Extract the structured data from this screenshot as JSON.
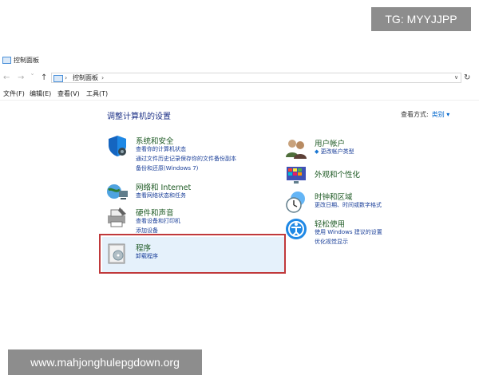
{
  "watermark": {
    "top_right": "TG: MYYJJPP",
    "bottom_left": "www.mahjonghulepgdown.org"
  },
  "window": {
    "title": "控制面板"
  },
  "address": {
    "breadcrumb": "控制面板",
    "sep": "›"
  },
  "nav": {
    "back": "←",
    "forward": "→",
    "up": "↑",
    "dropdown": "∨",
    "refresh": "↻"
  },
  "menu": [
    "文件(F)",
    "编辑(E)",
    "查看(V)",
    "工具(T)"
  ],
  "main": {
    "heading": "调整计算机的设置",
    "view_by_label": "查看方式:",
    "view_by_value": "类别 ▾"
  },
  "categories_left": [
    {
      "title": "系统和安全",
      "links": [
        "查看你的计算机状态",
        "通过文件历史记录保存你的文件备份副本",
        "备份和还原(Windows 7)"
      ]
    },
    {
      "title": "网络和 Internet",
      "links": [
        "查看网络状态和任务"
      ]
    },
    {
      "title": "硬件和声音",
      "links": [
        "查看设备和打印机",
        "添加设备"
      ]
    },
    {
      "title": "程序",
      "links": [
        "卸载程序"
      ]
    }
  ],
  "categories_right": [
    {
      "title": "用户帐户",
      "links": [
        "更改帐户类型"
      ]
    },
    {
      "title": "外观和个性化",
      "links": []
    },
    {
      "title": "时钟和区域",
      "links": [
        "更改日期、时间或数字格式"
      ]
    },
    {
      "title": "轻松使用",
      "links": [
        "使用 Windows 建议的设置",
        "优化视觉显示"
      ]
    }
  ],
  "colors": {
    "heading": "#1e3287",
    "category_title": "#1e5a24",
    "link": "#1a3f99",
    "highlight": "#e5f1fb",
    "selection_border": "#c0393b"
  }
}
